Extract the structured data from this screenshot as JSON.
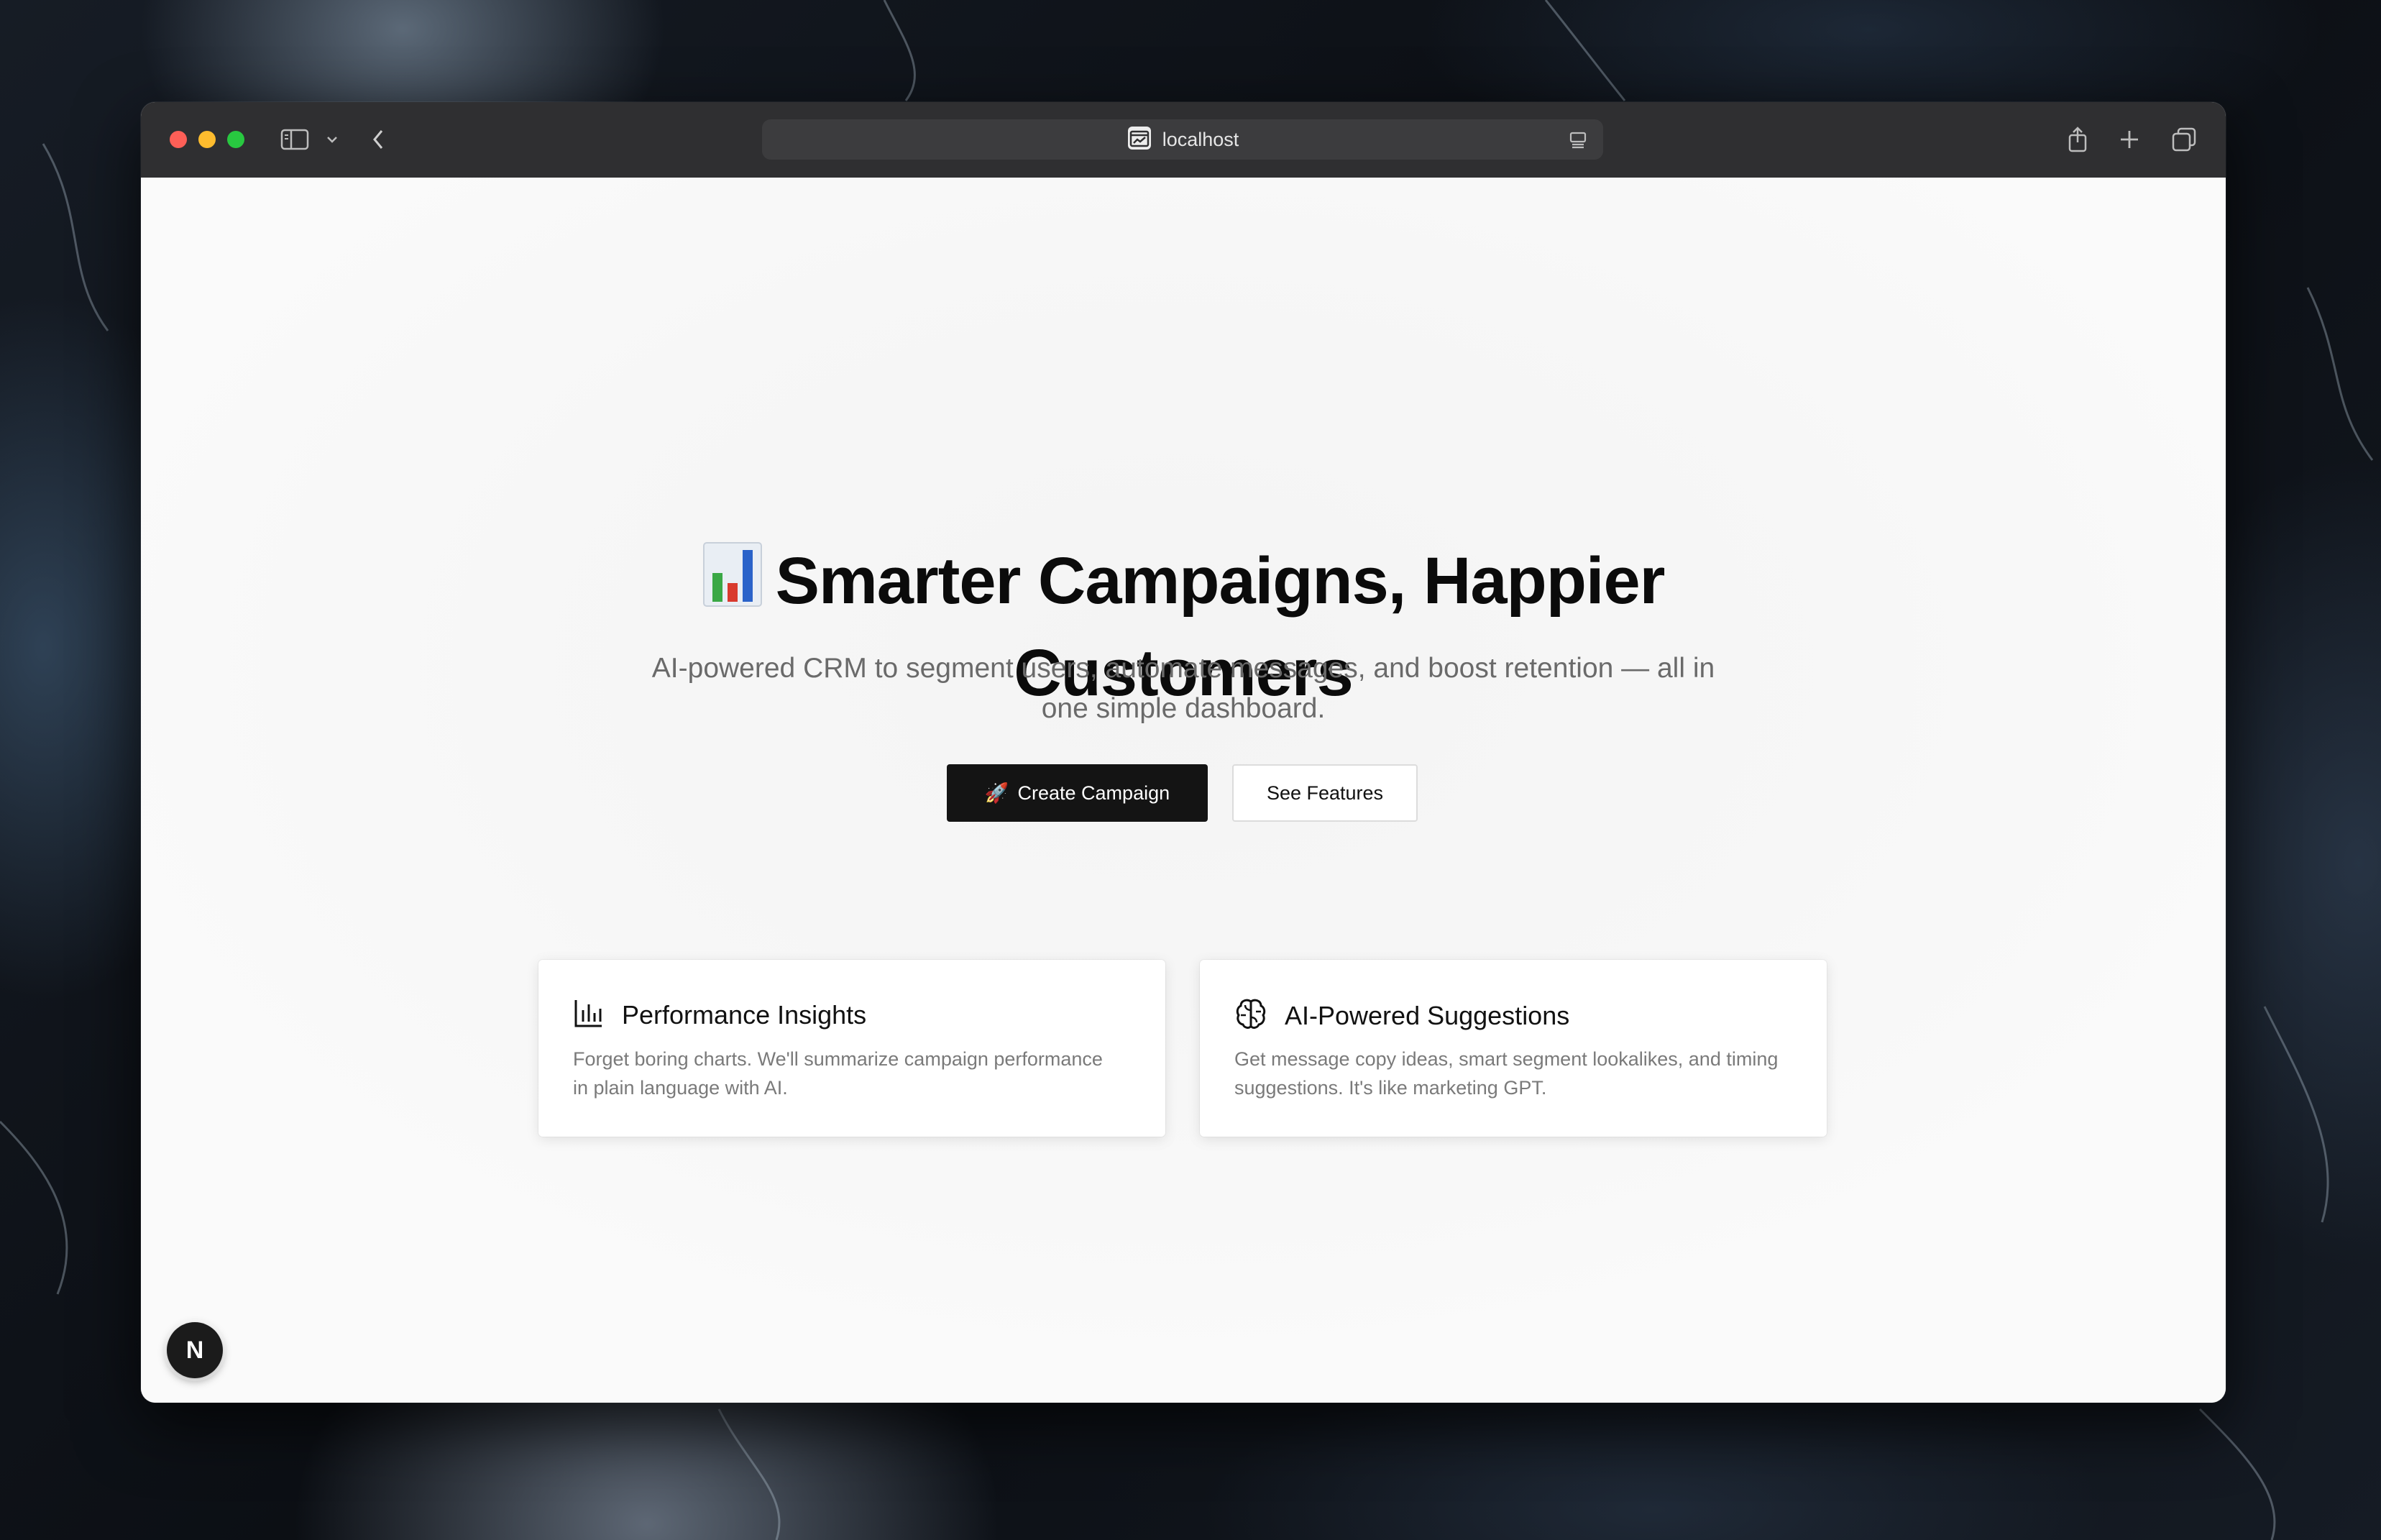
{
  "browser": {
    "url": "localhost",
    "icons": {
      "sidebar": "sidebar-icon",
      "chevron": "chevron-down-icon",
      "back": "back-icon",
      "reader": "reader-icon",
      "share": "share-icon",
      "new_tab": "plus-icon",
      "tabs": "tabs-overview-icon"
    }
  },
  "hero": {
    "title_line1": "Smarter Campaigns, Happier",
    "title_line2": "Customers",
    "subtitle_line1": "AI-powered CRM to segment users, automate messages, and boost retention — all in",
    "subtitle_line2": "one simple dashboard.",
    "primary_cta": {
      "emoji": "🚀",
      "label": "Create Campaign"
    },
    "secondary_cta": {
      "label": "See Features"
    }
  },
  "features": [
    {
      "title": "Performance Insights",
      "icon": "bar-chart-icon",
      "desc_line1": "Forget boring charts. We'll summarize campaign performance",
      "desc_line2": "in plain language with AI."
    },
    {
      "title": "AI-Powered Suggestions",
      "icon": "brain-icon",
      "desc_line1": "Get message copy ideas, smart segment lookalikes, and timing",
      "desc_line2": "suggestions. It's like marketing GPT."
    }
  ],
  "dev_badge": {
    "label": "N"
  },
  "colors": {
    "primary_button": "#141414",
    "text_dark": "#0b0b0b",
    "text_muted": "#6a6a6a"
  }
}
